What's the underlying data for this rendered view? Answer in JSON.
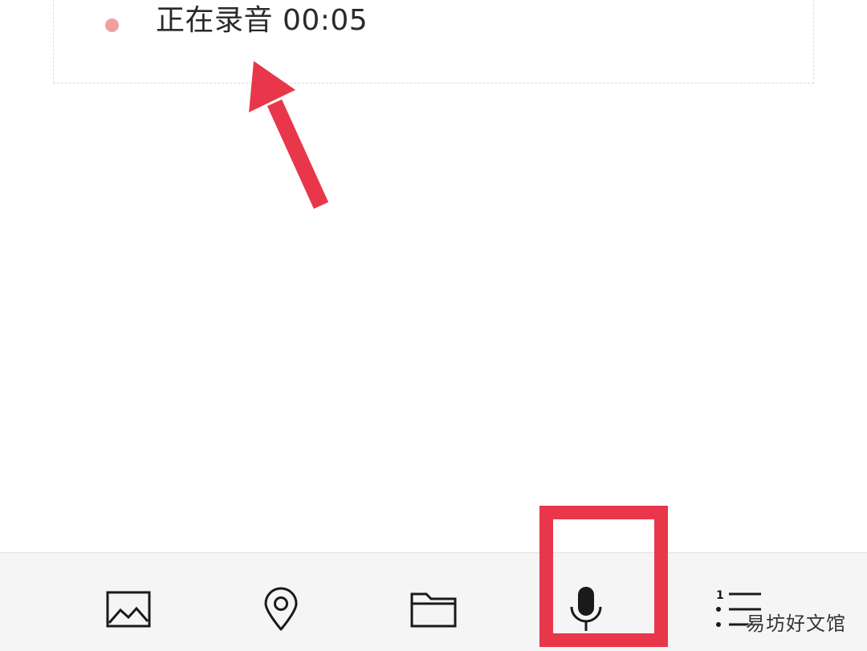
{
  "recording": {
    "status_text": "正在录音 00:05",
    "dot_color": "#f0a0a0"
  },
  "annotation": {
    "arrow_color": "#e8374b",
    "highlight_color": "#e8374b"
  },
  "toolbar": {
    "items": [
      {
        "icon": "image-icon",
        "label": "图片"
      },
      {
        "icon": "location-pin-icon",
        "label": "位置"
      },
      {
        "icon": "folder-icon",
        "label": "文件"
      },
      {
        "icon": "microphone-icon",
        "label": "录音"
      },
      {
        "icon": "numbered-list-icon",
        "label": "列表"
      }
    ]
  },
  "watermark": {
    "text": "易坊好文馆"
  }
}
